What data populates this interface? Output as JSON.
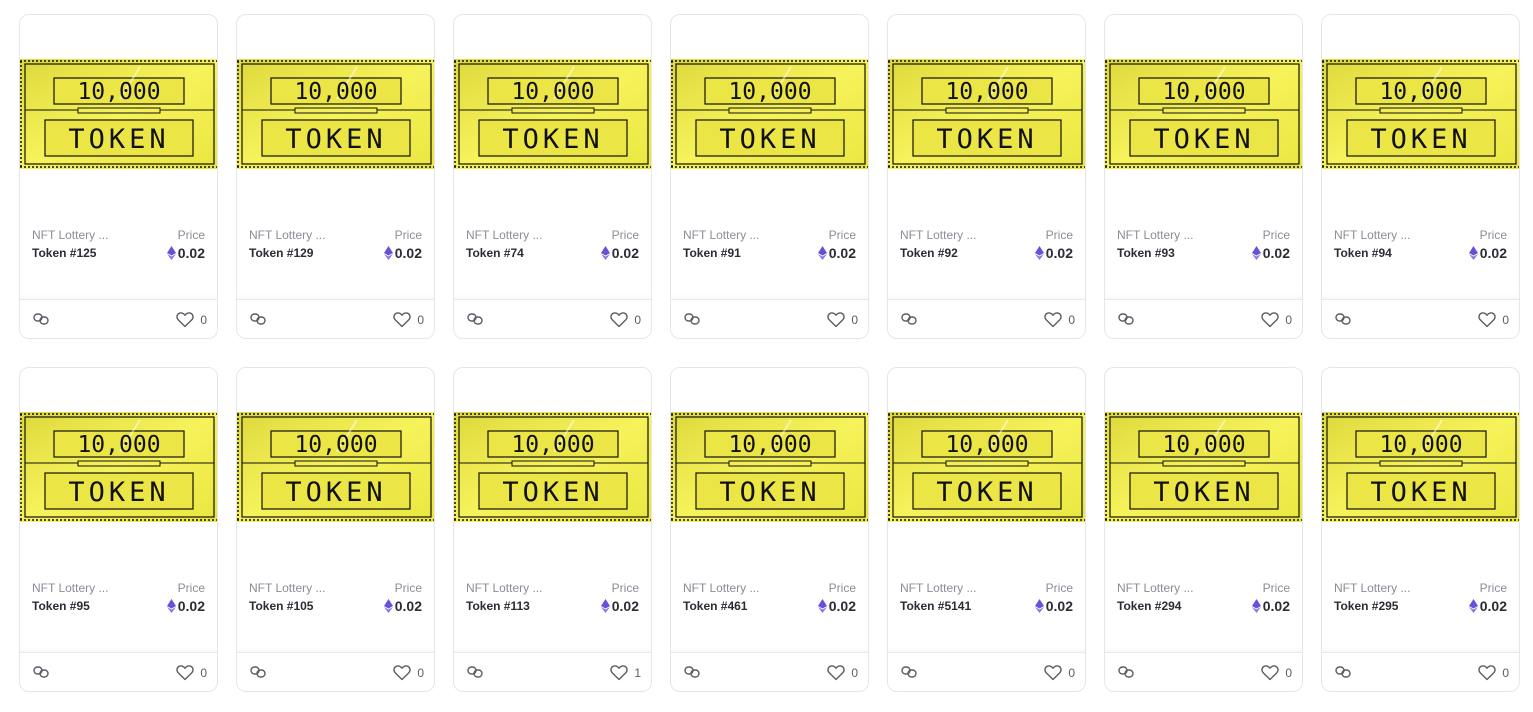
{
  "colors": {
    "ticket_yellow": "#f1ec4a",
    "ticket_outline": "#111111",
    "eth_purple": "#6b4fd8",
    "heart_stroke": "#5a5d65"
  },
  "ticket": {
    "amount_text": "10,000",
    "token_text": "TOKEN"
  },
  "price_label": "Price",
  "icons": {
    "link": "link-icon",
    "heart": "heart-icon",
    "currency": "ethereum-icon"
  },
  "cards": [
    {
      "collection": "NFT Lottery ...",
      "token": "Token #125",
      "price": "0.02",
      "likes": "0"
    },
    {
      "collection": "NFT Lottery ...",
      "token": "Token #129",
      "price": "0.02",
      "likes": "0"
    },
    {
      "collection": "NFT Lottery ...",
      "token": "Token #74",
      "price": "0.02",
      "likes": "0"
    },
    {
      "collection": "NFT Lottery ...",
      "token": "Token #91",
      "price": "0.02",
      "likes": "0"
    },
    {
      "collection": "NFT Lottery ...",
      "token": "Token #92",
      "price": "0.02",
      "likes": "0"
    },
    {
      "collection": "NFT Lottery ...",
      "token": "Token #93",
      "price": "0.02",
      "likes": "0"
    },
    {
      "collection": "NFT Lottery ...",
      "token": "Token #94",
      "price": "0.02",
      "likes": "0"
    },
    {
      "collection": "NFT Lottery ...",
      "token": "Token #95",
      "price": "0.02",
      "likes": "0"
    },
    {
      "collection": "NFT Lottery ...",
      "token": "Token #105",
      "price": "0.02",
      "likes": "0"
    },
    {
      "collection": "NFT Lottery ...",
      "token": "Token #113",
      "price": "0.02",
      "likes": "1"
    },
    {
      "collection": "NFT Lottery ...",
      "token": "Token #461",
      "price": "0.02",
      "likes": "0"
    },
    {
      "collection": "NFT Lottery ...",
      "token": "Token #5141",
      "price": "0.02",
      "likes": "0"
    },
    {
      "collection": "NFT Lottery ...",
      "token": "Token #294",
      "price": "0.02",
      "likes": "0"
    },
    {
      "collection": "NFT Lottery ...",
      "token": "Token #295",
      "price": "0.02",
      "likes": "0"
    }
  ]
}
